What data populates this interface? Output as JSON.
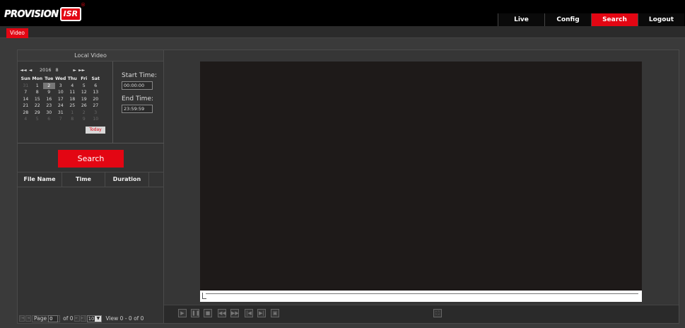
{
  "logo": {
    "word": "PROVISION",
    "badge": "ISR",
    "mark": "®"
  },
  "nav": {
    "items": [
      {
        "label": "Live"
      },
      {
        "label": "Config"
      },
      {
        "label": "Search"
      },
      {
        "label": "Logout"
      }
    ],
    "active": "Search"
  },
  "tabs": {
    "video": "Video"
  },
  "local": {
    "title": "Local Video"
  },
  "calendar": {
    "year": "2016",
    "month": "8",
    "prev_year": "◄◄",
    "prev_month": "◄",
    "next_month": "►",
    "next_year": "►►",
    "weekdays": [
      "Sun",
      "Mon",
      "Tue",
      "Wed",
      "Thu",
      "Fri",
      "Sat"
    ],
    "days": [
      "31",
      "1",
      "2",
      "3",
      "4",
      "5",
      "6",
      "7",
      "8",
      "9",
      "10",
      "11",
      "12",
      "13",
      "14",
      "15",
      "16",
      "17",
      "18",
      "19",
      "20",
      "21",
      "22",
      "23",
      "24",
      "25",
      "26",
      "27",
      "28",
      "29",
      "30",
      "31",
      "1",
      "2",
      "3",
      "4",
      "5",
      "6",
      "7",
      "8",
      "9",
      "10"
    ],
    "selected_index": 2,
    "other_month_indices": [
      0,
      32,
      33,
      34,
      35,
      36,
      37,
      38,
      39,
      40,
      41
    ],
    "today_label": "Today"
  },
  "time": {
    "start_label": "Start Time:",
    "start_value": "00:00:00",
    "end_label": "End Time:",
    "end_value": "23:59:59"
  },
  "search": {
    "button_label": "Search"
  },
  "files": {
    "columns": [
      "File Name",
      "Time",
      "Duration"
    ],
    "rows": []
  },
  "pager": {
    "page_label": "Page",
    "page_value": "0",
    "of_label": "of 0",
    "per_page": "10",
    "view_label": "View 0 - 0 of 0",
    "first": "|◄",
    "prev": "◄",
    "next": "►",
    "last": "►|"
  },
  "player": {
    "progress": 0
  },
  "controls": {
    "play": "▶",
    "pause": "❚❚",
    "stop": "■",
    "slow": "◀◀",
    "fast": "▶▶",
    "prev_frame": "|◀",
    "next_frame": "▶|",
    "snapshot": "▣",
    "fullscreen": "⛶"
  },
  "colors": {
    "accent": "#e30613",
    "background": "#3a3a3a",
    "player": "#1e1a19"
  }
}
